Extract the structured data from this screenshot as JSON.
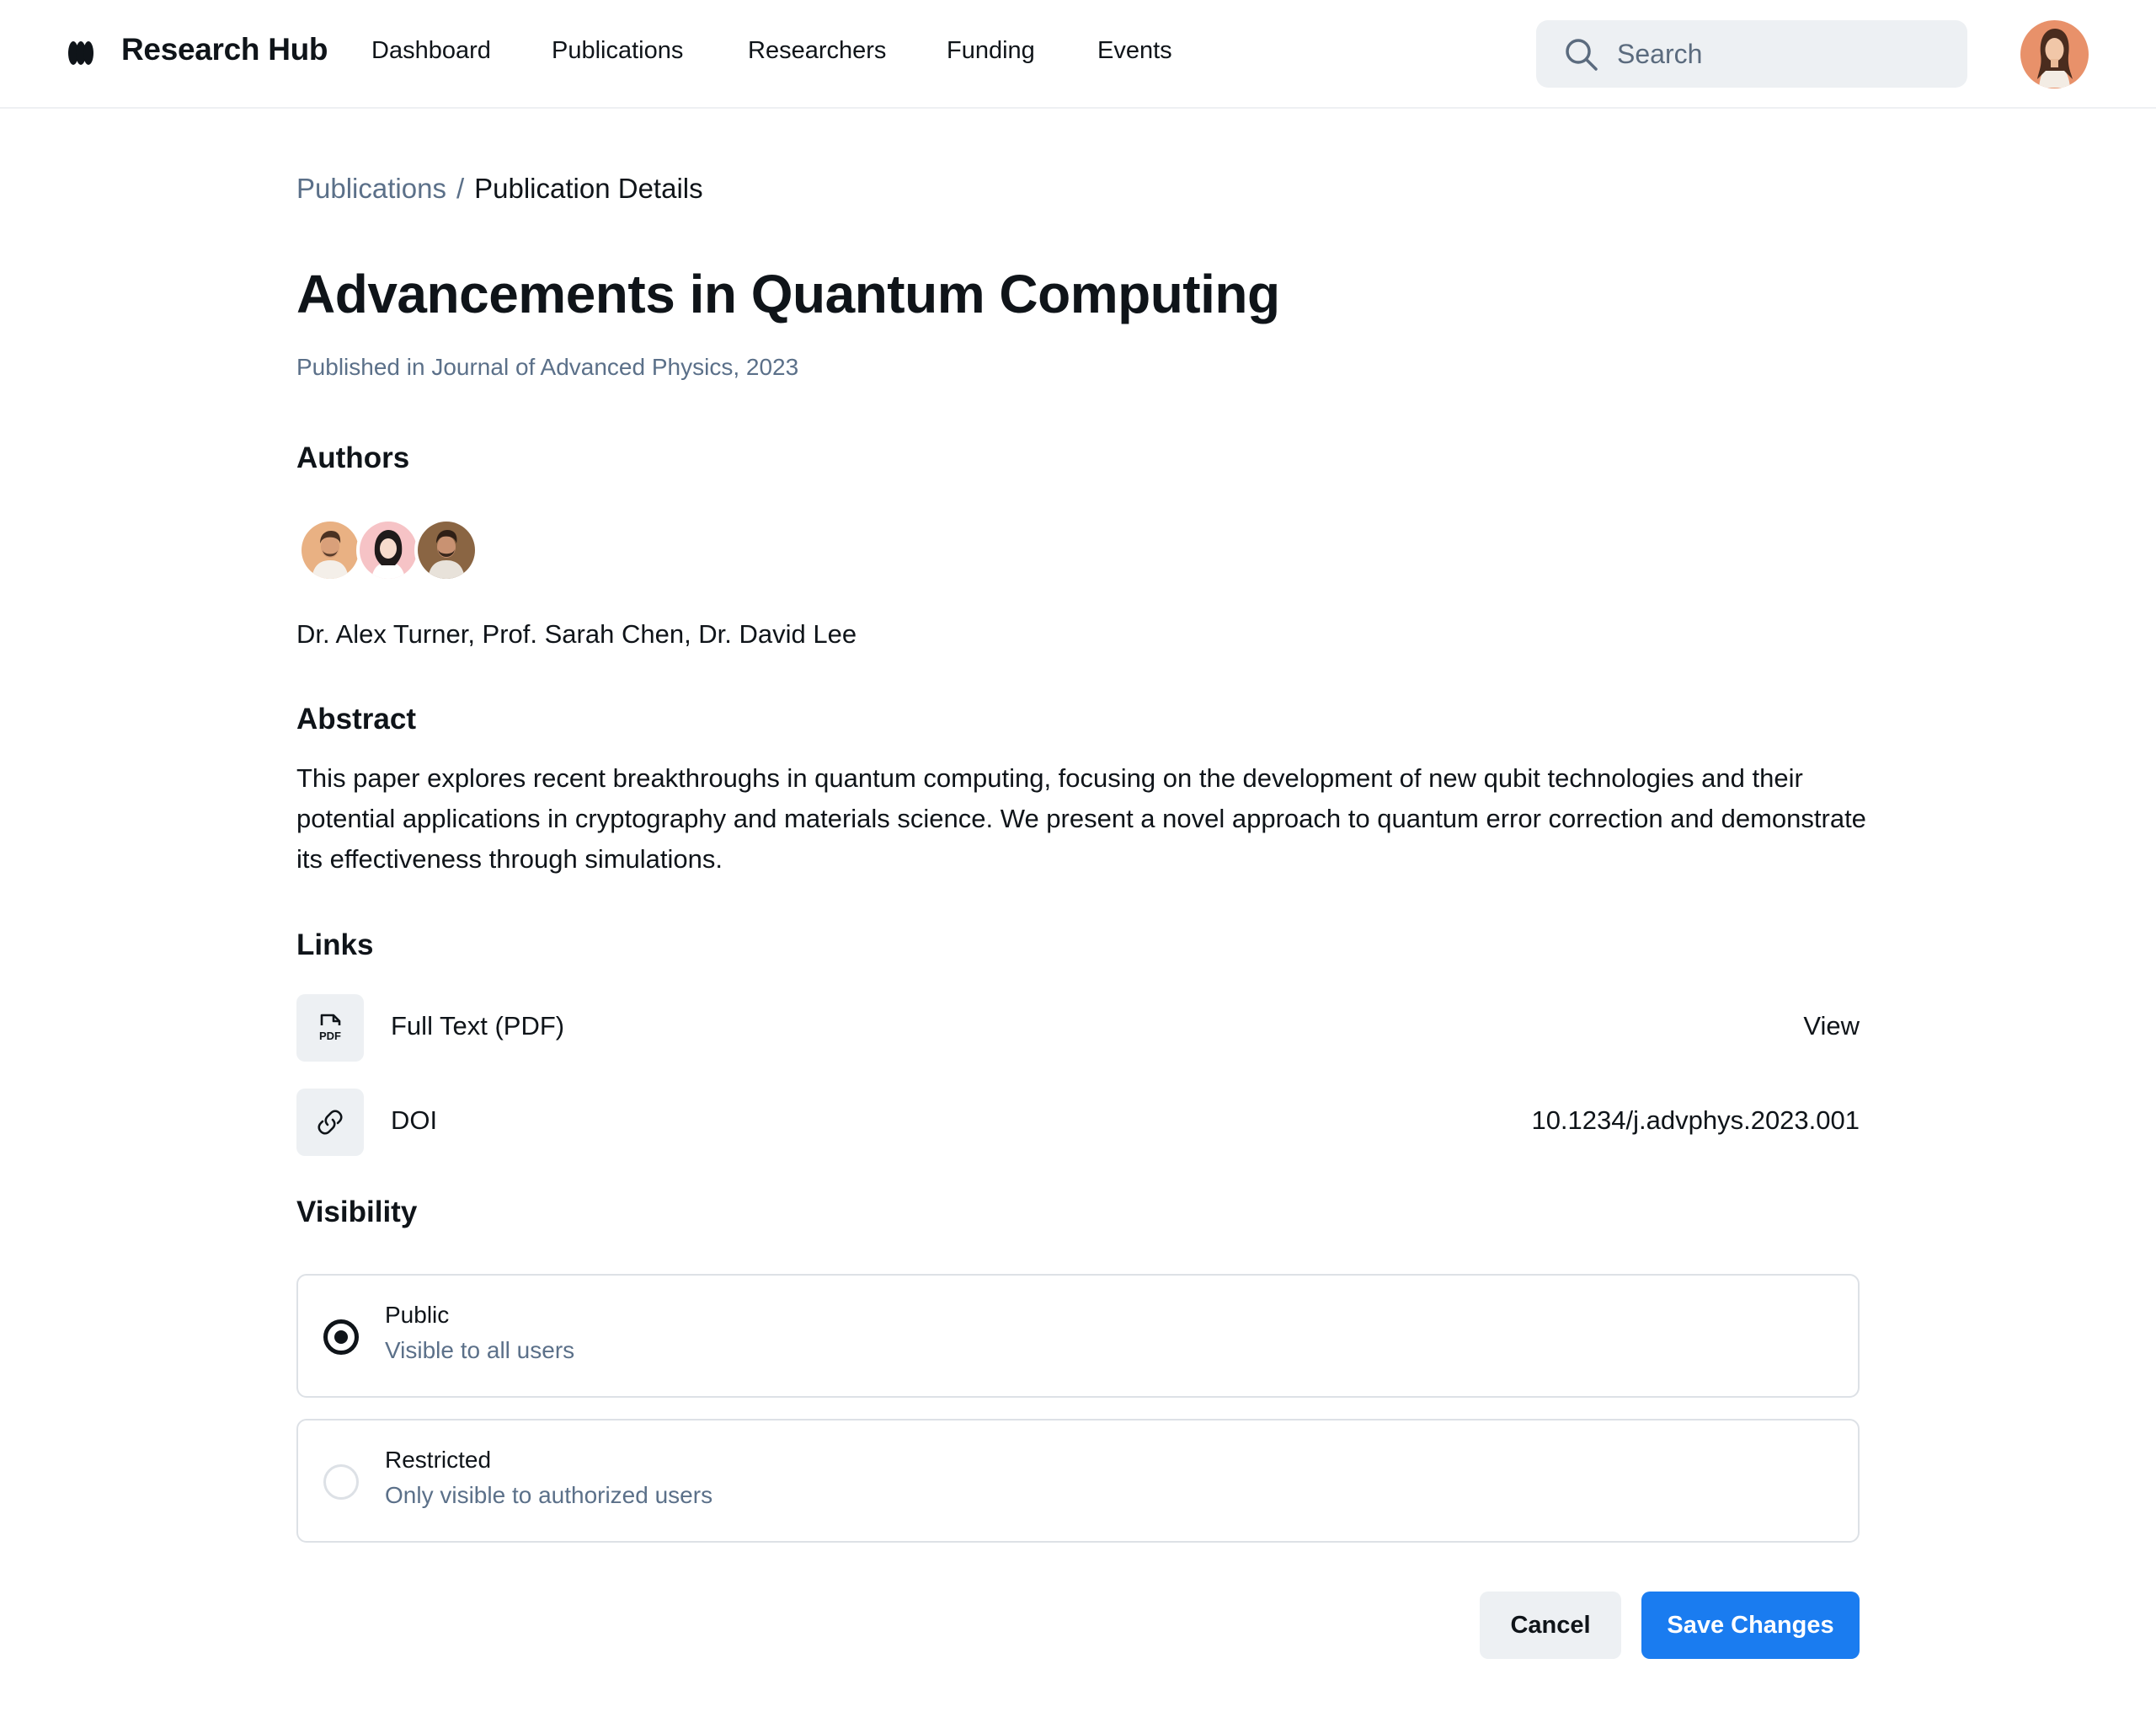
{
  "header": {
    "brand": "Research Hub",
    "nav": [
      "Dashboard",
      "Publications",
      "Researchers",
      "Funding",
      "Events"
    ],
    "search_placeholder": "Search"
  },
  "breadcrumb": {
    "parent": "Publications",
    "separator": "/",
    "current": "Publication Details"
  },
  "publication": {
    "title": "Advancements in Quantum Computing",
    "subtitle": "Published in Journal of Advanced Physics, 2023"
  },
  "authors": {
    "heading": "Authors",
    "names": "Dr. Alex Turner, Prof. Sarah Chen, Dr. David Lee"
  },
  "abstract": {
    "heading": "Abstract",
    "text": "This paper explores recent breakthroughs in quantum computing, focusing on the development of new qubit technologies and their potential applications in cryptography and materials science. We present a novel approach to quantum error correction and demonstrate its effectiveness through simulations."
  },
  "links": {
    "heading": "Links",
    "items": [
      {
        "label": "Full Text (PDF)",
        "value": "View",
        "icon": "pdf-icon"
      },
      {
        "label": "DOI",
        "value": "10.1234/j.advphys.2023.001",
        "icon": "link-icon"
      }
    ]
  },
  "visibility": {
    "heading": "Visibility",
    "options": [
      {
        "title": "Public",
        "description": "Visible to all users",
        "selected": true
      },
      {
        "title": "Restricted",
        "description": "Only visible to authorized users",
        "selected": false
      }
    ]
  },
  "actions": {
    "cancel": "Cancel",
    "save": "Save Changes"
  },
  "colors": {
    "accent": "#1a7cf0",
    "muted_text": "#5b7089",
    "surface": "#edf0f3"
  }
}
